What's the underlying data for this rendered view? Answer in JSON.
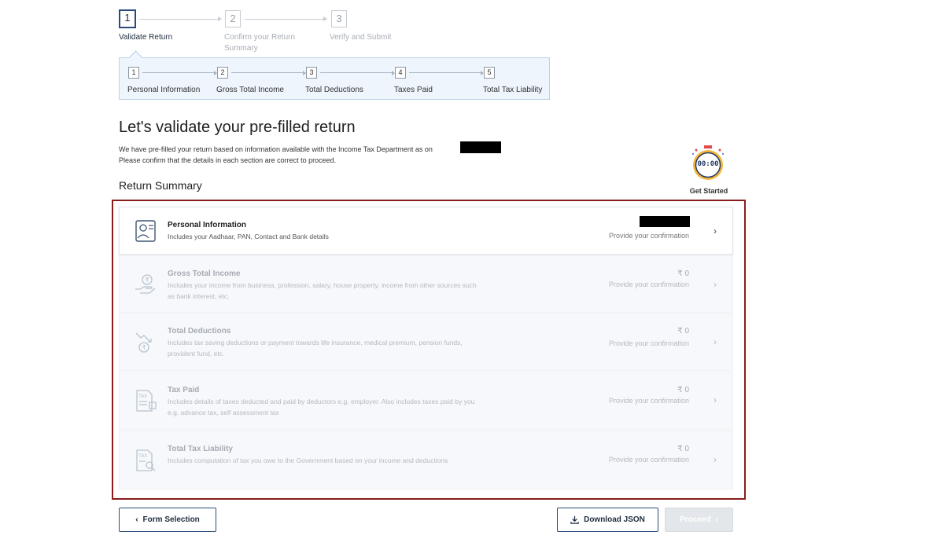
{
  "stepper": {
    "steps": [
      {
        "number": "1",
        "label": "Validate Return"
      },
      {
        "number": "2",
        "label": "Confirm your Return Summary"
      },
      {
        "number": "3",
        "label": "Verify and Submit"
      }
    ]
  },
  "substeps": [
    {
      "number": "1",
      "label": "Personal Information"
    },
    {
      "number": "2",
      "label": "Gross Total Income"
    },
    {
      "number": "3",
      "label": "Total Deductions"
    },
    {
      "number": "4",
      "label": "Taxes Paid"
    },
    {
      "number": "5",
      "label": "Total Tax Liability"
    }
  ],
  "page": {
    "title": "Let's validate your pre-filled return",
    "desc_line1": "We have pre-filled your return based on information available with the Income Tax Department as on",
    "desc_line2": "Please confirm that the details in each section are correct to proceed.",
    "summary_heading": "Return Summary"
  },
  "timer": {
    "display": "00:00",
    "label": "Get Started"
  },
  "sections": [
    {
      "name": "Personal Information",
      "desc": "Includes your Aadhaar, PAN, Contact and Bank details",
      "amount": "",
      "status": "Provide your confirmation",
      "icon": "person-id-icon"
    },
    {
      "name": "Gross Total Income",
      "desc": "Includes your income from business, profession, salary, house property, income from other sources such as bank interest, etc.",
      "amount": "₹ 0",
      "status": "Provide your confirmation",
      "icon": "hand-rupee-icon"
    },
    {
      "name": "Total Deductions",
      "desc": "Includes tax saving deductions or payment towards life insurance, medical premium, pension funds, provident fund, etc.",
      "amount": "₹ 0",
      "status": "Provide your confirmation",
      "icon": "rupee-down-icon"
    },
    {
      "name": "Tax Paid",
      "desc": "Includes details of taxes deducted and paid by deductors e.g. employer. Also includes taxes paid by you e.g. advance tax, self assessment tax",
      "amount": "₹ 0",
      "status": "Provide your confirmation",
      "icon": "tax-document-icon"
    },
    {
      "name": "Total Tax Liability",
      "desc": "Includes computation of tax you owe to the Government based on your income and deductions",
      "amount": "₹ 0",
      "status": "Provide your confirmation",
      "icon": "tax-search-icon"
    }
  ],
  "buttons": {
    "form_selection": "Form Selection",
    "download_json": "Download JSON",
    "proceed": "Proceed"
  }
}
